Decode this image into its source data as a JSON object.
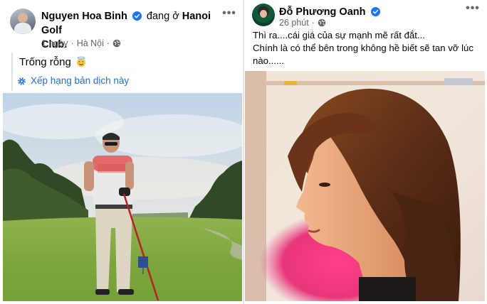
{
  "left_post": {
    "author": "Nguyen Hoa Binh",
    "checkin": "đang ở",
    "place_line1": "Hanoi Golf",
    "place_line2": "Club.",
    "time": "1 ngày",
    "location": "Hà Nội",
    "status": "Trống rỗng",
    "emoji": "smiling-face-with-halo",
    "translate": "Xếp hạng bản dịch này"
  },
  "right_post": {
    "author": "Đỗ Phương Oanh",
    "time": "26 phút",
    "caption_lines": [
      "Thì ra....cái giá của sự mạnh mẽ rất đắt...",
      "Chính là có thể bên trong không hề biết sẽ tan vỡ lúc",
      "nào......"
    ]
  },
  "colors": {
    "verified_blue": "#1877f2",
    "meta_gray": "#65676b",
    "link_blue": "#216fdb",
    "divider": "#e4e6eb"
  },
  "icons": [
    "verified-badge-icon",
    "globe-icon",
    "more-options-icon",
    "translate-gear-icon",
    "halo-smile-emoji"
  ]
}
